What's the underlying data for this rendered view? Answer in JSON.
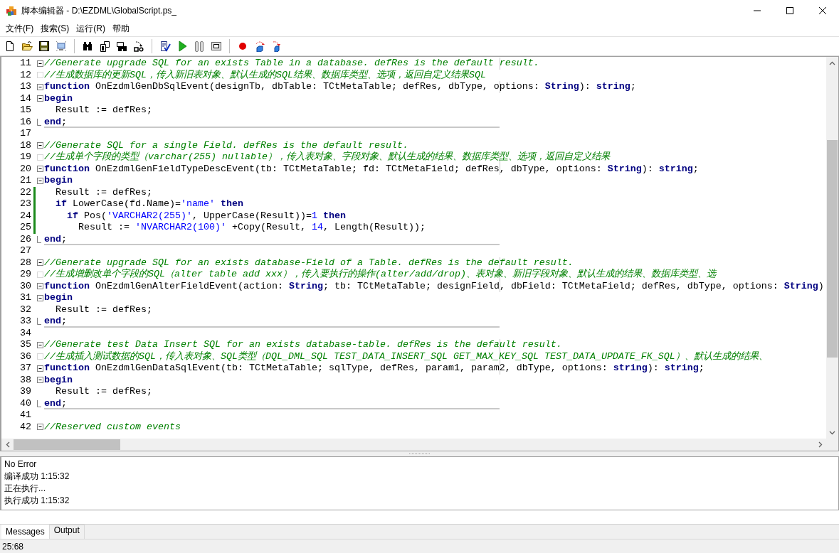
{
  "window": {
    "title": "脚本编辑器 - D:\\EZDML\\GlobalScript.ps_"
  },
  "menu": [
    "文件(F)",
    "搜索(S)",
    "运行(R)",
    "帮助"
  ],
  "editor": {
    "lines": [
      {
        "number": "11",
        "kind": "fold",
        "modified": false,
        "separator": false,
        "tokens": [
          {
            "kind": "comment",
            "text": "//Generate upgrade SQL for an exists Table in a database. defRes is the default result."
          }
        ]
      },
      {
        "number": "12",
        "kind": "branch",
        "modified": false,
        "separator": false,
        "tokens": [
          {
            "kind": "comment",
            "text": "//生成数据库的更新SQL，传入新旧表对象、默认生成的SQL结果、数据库类型、选项，返回自定义结果SQL"
          }
        ]
      },
      {
        "number": "13",
        "kind": "fold",
        "modified": false,
        "separator": false,
        "tokens": [
          {
            "kind": "keyword",
            "text": "function"
          },
          {
            "kind": "plain",
            "text": " OnEzdmlGenDbSqlEvent(designTb, dbTable: TCtMetaTable; defRes, dbType, options: "
          },
          {
            "kind": "keyword",
            "text": "String"
          },
          {
            "kind": "plain",
            "text": "): "
          },
          {
            "kind": "keyword",
            "text": "string"
          },
          {
            "kind": "plain",
            "text": ";"
          }
        ]
      },
      {
        "number": "14",
        "kind": "fold",
        "modified": false,
        "separator": false,
        "tokens": [
          {
            "kind": "keyword",
            "text": "begin"
          }
        ]
      },
      {
        "number": "15",
        "kind": "plain",
        "modified": false,
        "separator": false,
        "tokens": [
          {
            "kind": "plain",
            "text": "  Result := defRes;"
          }
        ]
      },
      {
        "number": "16",
        "kind": "fold-end",
        "modified": false,
        "separator": true,
        "tokens": [
          {
            "kind": "keyword",
            "text": "end"
          },
          {
            "kind": "plain",
            "text": ";"
          }
        ]
      },
      {
        "number": "17",
        "kind": "plain",
        "modified": false,
        "separator": false
      },
      {
        "number": "18",
        "kind": "fold",
        "modified": false,
        "separator": false,
        "tokens": [
          {
            "kind": "comment",
            "text": "//Generate SQL for a single Field. defRes is the default result."
          }
        ]
      },
      {
        "number": "19",
        "kind": "branch",
        "modified": false,
        "separator": false,
        "tokens": [
          {
            "kind": "comment",
            "text": "//生成单个字段的类型（varchar(255) nullable），传入表对象、字段对象、默认生成的结果、数据库类型、选项，返回自定义结果"
          }
        ]
      },
      {
        "number": "20",
        "kind": "fold",
        "modified": false,
        "separator": false,
        "tokens": [
          {
            "kind": "keyword",
            "text": "function"
          },
          {
            "kind": "plain",
            "text": " OnEzdmlGenFieldTypeDescEvent(tb: TCtMetaTable; fd: TCtMetaField; defRes, dbType, options: "
          },
          {
            "kind": "keyword",
            "text": "String"
          },
          {
            "kind": "plain",
            "text": "): "
          },
          {
            "kind": "keyword",
            "text": "string"
          },
          {
            "kind": "plain",
            "text": ";"
          }
        ]
      },
      {
        "number": "21",
        "kind": "fold",
        "modified": false,
        "separator": false,
        "tokens": [
          {
            "kind": "keyword",
            "text": "begin"
          }
        ]
      },
      {
        "number": "22",
        "kind": "plain",
        "modified": true,
        "separator": false,
        "tokens": [
          {
            "kind": "plain",
            "text": "  Result := defRes;"
          }
        ]
      },
      {
        "number": "23",
        "kind": "plain",
        "modified": true,
        "separator": false,
        "tokens": [
          {
            "kind": "keyword",
            "text": "  if"
          },
          {
            "kind": "plain",
            "text": " LowerCase(fd.Name)="
          },
          {
            "kind": "string",
            "text": "'name'"
          },
          {
            "kind": "keyword",
            "text": " then"
          }
        ]
      },
      {
        "number": "24",
        "kind": "plain",
        "modified": true,
        "separator": false,
        "tokens": [
          {
            "kind": "keyword",
            "text": "    if"
          },
          {
            "kind": "plain",
            "text": " Pos("
          },
          {
            "kind": "string",
            "text": "'VARCHAR2(255)'"
          },
          {
            "kind": "plain",
            "text": ", UpperCase(Result))="
          },
          {
            "kind": "number",
            "text": "1"
          },
          {
            "kind": "keyword",
            "text": " then"
          }
        ]
      },
      {
        "number": "25",
        "kind": "plain",
        "modified": true,
        "separator": false,
        "tokens": [
          {
            "kind": "plain",
            "text": "      Result := "
          },
          {
            "kind": "string",
            "text": "'NVARCHAR2(100)'"
          },
          {
            "kind": "plain",
            "text": " +Copy(Result, "
          },
          {
            "kind": "number",
            "text": "14"
          },
          {
            "kind": "plain",
            "text": ", Length(Result));"
          }
        ]
      },
      {
        "number": "26",
        "kind": "fold-end",
        "modified": false,
        "separator": true,
        "tokens": [
          {
            "kind": "keyword",
            "text": "end"
          },
          {
            "kind": "plain",
            "text": ";"
          }
        ]
      },
      {
        "number": "27",
        "kind": "plain",
        "modified": false,
        "separator": false
      },
      {
        "number": "28",
        "kind": "fold",
        "modified": false,
        "separator": false,
        "tokens": [
          {
            "kind": "comment",
            "text": "//Generate upgrade SQL for an exists database-Field of a Table. defRes is the default result."
          }
        ]
      },
      {
        "number": "29",
        "kind": "branch",
        "modified": false,
        "separator": false,
        "tokens": [
          {
            "kind": "comment",
            "text": "//生成增删改单个字段的SQL（alter table add xxx），传入要执行的操作(alter/add/drop)、表对象、新旧字段对象、默认生成的结果、数据库类型、选"
          }
        ]
      },
      {
        "number": "30",
        "kind": "fold",
        "modified": false,
        "separator": false,
        "tokens": [
          {
            "kind": "keyword",
            "text": "function"
          },
          {
            "kind": "plain",
            "text": " OnEzdmlGenAlterFieldEvent(action: "
          },
          {
            "kind": "keyword",
            "text": "String"
          },
          {
            "kind": "plain",
            "text": "; tb: TCtMetaTable; designField, dbField: TCtMetaField; defRes, dbType, options: "
          },
          {
            "kind": "keyword",
            "text": "String"
          },
          {
            "kind": "plain",
            "text": ")"
          }
        ]
      },
      {
        "number": "31",
        "kind": "fold",
        "modified": false,
        "separator": false,
        "tokens": [
          {
            "kind": "keyword",
            "text": "begin"
          }
        ]
      },
      {
        "number": "32",
        "kind": "plain",
        "modified": false,
        "separator": false,
        "tokens": [
          {
            "kind": "plain",
            "text": "  Result := defRes;"
          }
        ]
      },
      {
        "number": "33",
        "kind": "fold-end",
        "modified": false,
        "separator": true,
        "tokens": [
          {
            "kind": "keyword",
            "text": "end"
          },
          {
            "kind": "plain",
            "text": ";"
          }
        ]
      },
      {
        "number": "34",
        "kind": "plain",
        "modified": false,
        "separator": false
      },
      {
        "number": "35",
        "kind": "fold",
        "modified": false,
        "separator": false,
        "tokens": [
          {
            "kind": "comment",
            "text": "//Generate test Data Insert SQL for an exists database-table. defRes is the default result."
          }
        ]
      },
      {
        "number": "36",
        "kind": "branch",
        "modified": false,
        "separator": false,
        "tokens": [
          {
            "kind": "comment",
            "text": "//生成插入测试数据的SQL，传入表对象、SQL类型（DQL_DML_SQL TEST_DATA_INSERT_SQL GET_MAX_KEY_SQL TEST_DATA_UPDATE_FK_SQL）、默认生成的结果、"
          }
        ]
      },
      {
        "number": "37",
        "kind": "fold",
        "modified": false,
        "separator": false,
        "tokens": [
          {
            "kind": "keyword",
            "text": "function"
          },
          {
            "kind": "plain",
            "text": " OnEzdmlGenDataSqlEvent(tb: TCtMetaTable; sqlType, defRes, param1, param2, dbType, options: "
          },
          {
            "kind": "keyword",
            "text": "string"
          },
          {
            "kind": "plain",
            "text": "): "
          },
          {
            "kind": "keyword",
            "text": "string"
          },
          {
            "kind": "plain",
            "text": ";"
          }
        ]
      },
      {
        "number": "38",
        "kind": "fold",
        "modified": false,
        "separator": false,
        "tokens": [
          {
            "kind": "keyword",
            "text": "begin"
          }
        ]
      },
      {
        "number": "39",
        "kind": "plain",
        "modified": false,
        "separator": false,
        "tokens": [
          {
            "kind": "plain",
            "text": "  Result := defRes;"
          }
        ]
      },
      {
        "number": "40",
        "kind": "fold-end",
        "modified": false,
        "separator": true,
        "tokens": [
          {
            "kind": "keyword",
            "text": "end"
          },
          {
            "kind": "plain",
            "text": ";"
          }
        ]
      },
      {
        "number": "41",
        "kind": "plain",
        "modified": false,
        "separator": false
      },
      {
        "number": "42",
        "kind": "fold",
        "modified": false,
        "separator": false,
        "tokens": [
          {
            "kind": "comment",
            "text": "//Reserved custom events"
          }
        ]
      }
    ]
  },
  "messages": [
    "No Error",
    "编译成功 1:15:32",
    "正在执行...",
    "执行成功 1:15:32"
  ],
  "tabs": [
    {
      "label": "Messages",
      "selected": true
    },
    {
      "label": "Output",
      "selected": false
    }
  ],
  "status_bar": {
    "position": "25:68"
  }
}
